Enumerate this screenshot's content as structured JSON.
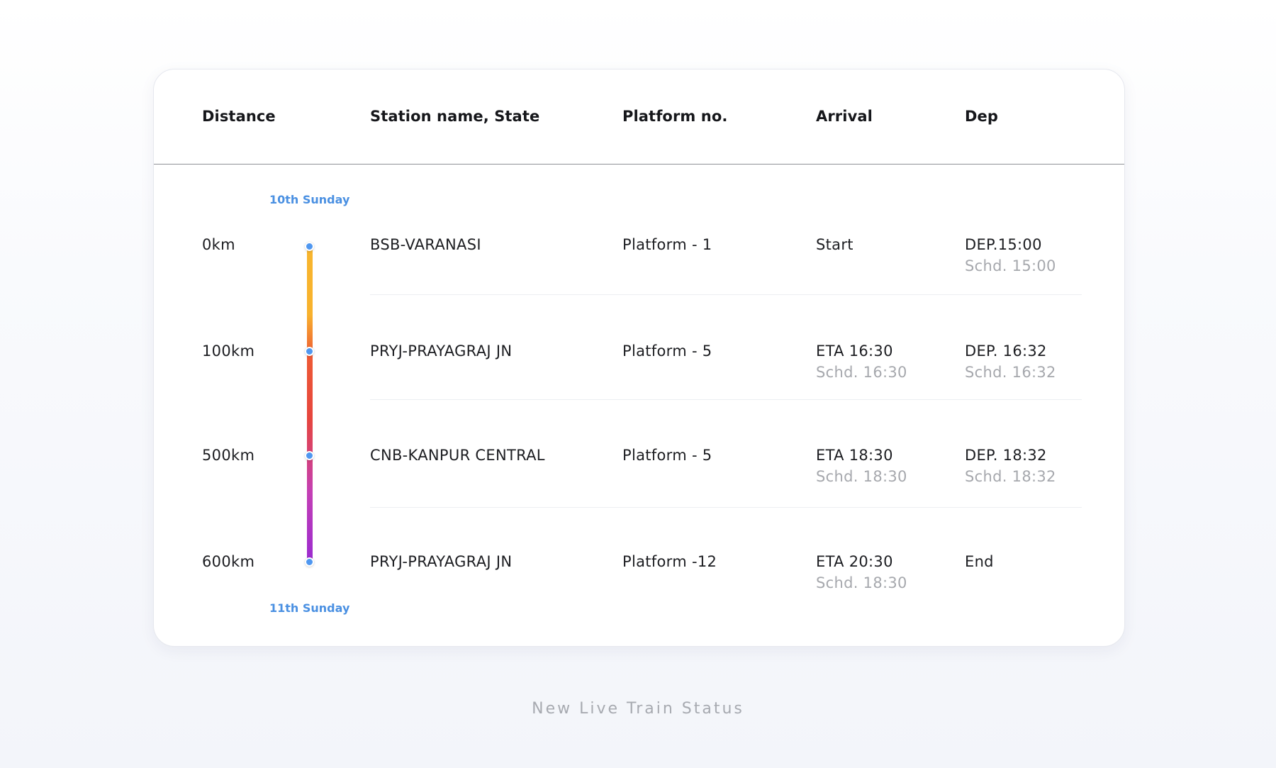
{
  "table": {
    "headers": {
      "distance": "Distance",
      "station": "Station name, State",
      "platform": "Platform no.",
      "arrival": "Arrival",
      "dep": "Dep"
    },
    "start_day": "10th Sunday",
    "end_day": "11th Sunday",
    "timeline_colors": {
      "start": "#f8b62e",
      "middle": "#e6453e",
      "end": "#9a2bd0",
      "dot": "#4f97f0",
      "day_label": "#4a90e2"
    },
    "rows": [
      {
        "distance": "0km",
        "station": "BSB-VARANASI",
        "platform": "Platform - 1",
        "arrival": "Start",
        "arrival_sched": "",
        "dep": "DEP.15:00",
        "dep_sched": "Schd. 15:00"
      },
      {
        "distance": "100km",
        "station": "PRYJ-PRAYAGRAJ JN",
        "platform": "Platform - 5",
        "arrival": "ETA 16:30",
        "arrival_sched": "Schd. 16:30",
        "dep": "DEP. 16:32",
        "dep_sched": "Schd. 16:32"
      },
      {
        "distance": "500km",
        "station": "CNB-KANPUR CENTRAL",
        "platform": "Platform - 5",
        "arrival": "ETA 18:30",
        "arrival_sched": "Schd. 18:30",
        "dep": "DEP. 18:32",
        "dep_sched": "Schd. 18:32"
      },
      {
        "distance": "600km",
        "station": "PRYJ-PRAYAGRAJ JN",
        "platform": "Platform -12",
        "arrival": "ETA 20:30",
        "arrival_sched": "Schd. 18:30",
        "dep": "End",
        "dep_sched": ""
      }
    ]
  },
  "caption": "New Live Train Status"
}
